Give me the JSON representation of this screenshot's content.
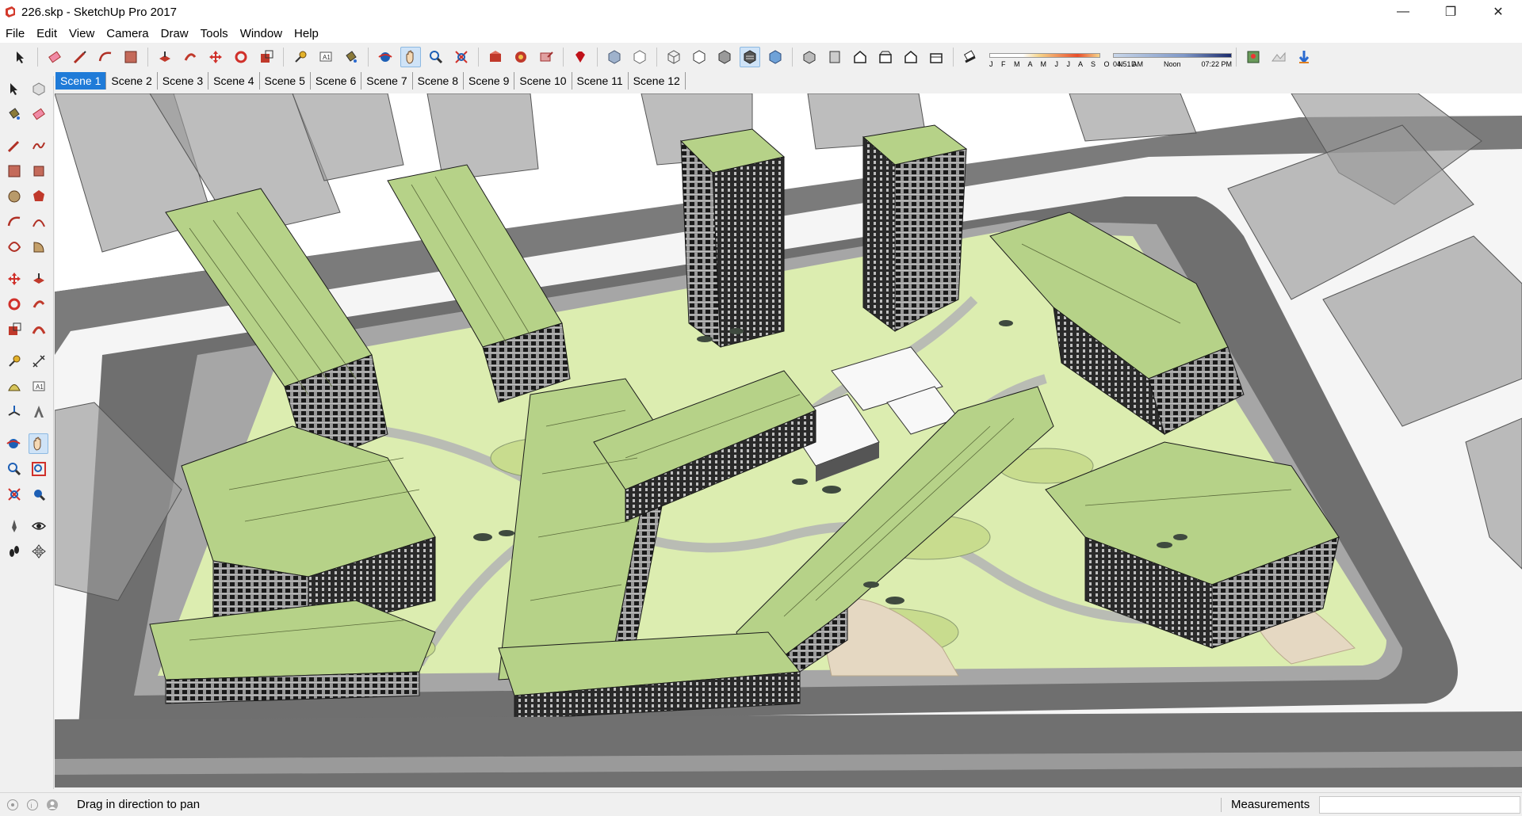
{
  "window": {
    "title": "226.skp - SketchUp Pro 2017",
    "minimize": "—",
    "restore": "❐",
    "close": "✕"
  },
  "menu": [
    "File",
    "Edit",
    "View",
    "Camera",
    "Draw",
    "Tools",
    "Window",
    "Help"
  ],
  "shadows": {
    "months": "J F M A M J J A S O N D",
    "time_start": "04:51 AM",
    "time_mid": "Noon",
    "time_end": "07:22 PM"
  },
  "scenes": [
    "Scene 1",
    "Scene 2",
    "Scene 3",
    "Scene 4",
    "Scene 5",
    "Scene 6",
    "Scene 7",
    "Scene 8",
    "Scene 9",
    "Scene 10",
    "Scene 11",
    "Scene 12"
  ],
  "active_scene": "Scene 1",
  "status": {
    "hint": "Drag in direction to pan",
    "measurements_label": "Measurements",
    "measurements_value": ""
  },
  "colors": {
    "accent": "#1f7bd8",
    "ground": "#dcedb0",
    "roof": "#b6d288",
    "road": "#6e6e6e",
    "context": "#a8a8a8"
  }
}
